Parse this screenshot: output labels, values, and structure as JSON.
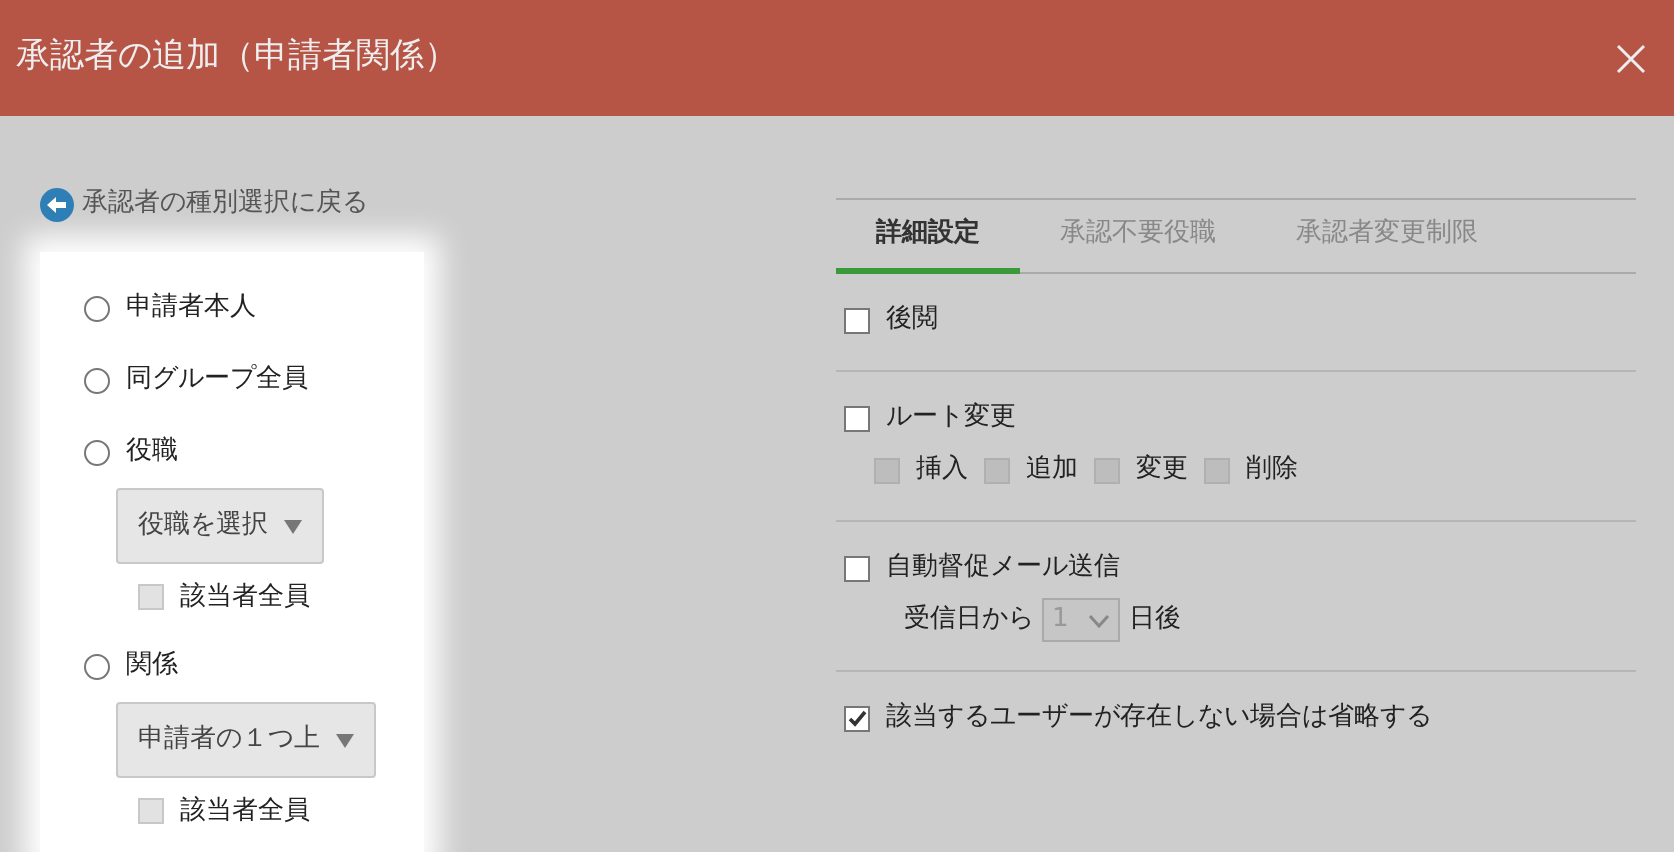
{
  "dialog": {
    "title": "承認者の追加（申請者関係）"
  },
  "back_link": "承認者の種別選択に戻る",
  "options": [
    {
      "label": "申請者本人",
      "selected": false
    },
    {
      "label": "同グループ全員",
      "selected": false
    },
    {
      "label": "役職",
      "selected": false,
      "select": {
        "value": "役職を選択"
      },
      "all": {
        "label": "該当者全員",
        "checked": false,
        "disabled": true
      }
    },
    {
      "label": "関係",
      "selected": false,
      "select": {
        "value": "申請者の１つ上"
      },
      "all": {
        "label": "該当者全員",
        "checked": false,
        "disabled": true
      }
    }
  ],
  "tabs": [
    {
      "label": "詳細設定",
      "selected": true
    },
    {
      "label": "承認不要役職",
      "selected": false
    },
    {
      "label": "承認者変更制限",
      "selected": false
    }
  ],
  "settings": [
    {
      "kind": "check",
      "label": "後閲",
      "checked": false
    },
    {
      "kind": "suboptions",
      "label": "ルート変更",
      "checked": false,
      "sub_options": [
        {
          "label": "挿入",
          "checked": false,
          "disabled": true
        },
        {
          "label": "追加",
          "checked": false,
          "disabled": true
        },
        {
          "label": "変更",
          "checked": false,
          "disabled": true
        },
        {
          "label": "削除",
          "checked": false,
          "disabled": true
        }
      ]
    },
    {
      "kind": "delay",
      "label": "自動督促メール送信",
      "checked": false,
      "delay": {
        "prefix": "受信日から",
        "value": "1",
        "disabled": true,
        "suffix": "日後"
      }
    },
    {
      "kind": "check",
      "label": "該当するユーザーが存在しない場合は省略する",
      "checked": true
    }
  ]
}
